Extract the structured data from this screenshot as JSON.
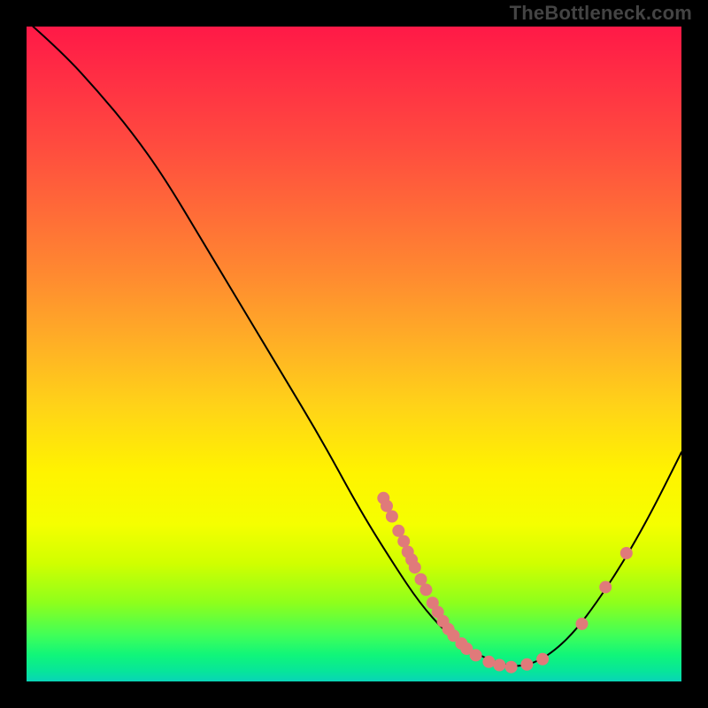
{
  "watermark": "TheBottleneck.com",
  "colors": {
    "curve": "#000000",
    "points": "#e07a7a",
    "gradient_top": "#ff1947",
    "gradient_bottom": "#09d4b8",
    "background": "#000000"
  },
  "chart_data": {
    "type": "line",
    "title": "",
    "xlabel": "",
    "ylabel": "",
    "x_range": [
      0,
      100
    ],
    "y_range": [
      0,
      100
    ],
    "note": "Axes are unlabeled; values are % positions in the 740x740 plot; y measured from top.",
    "curve": [
      [
        1,
        0
      ],
      [
        5.5,
        4
      ],
      [
        11,
        10
      ],
      [
        16,
        16
      ],
      [
        21,
        23
      ],
      [
        27,
        33
      ],
      [
        33,
        43
      ],
      [
        39,
        53
      ],
      [
        45,
        63
      ],
      [
        51,
        74
      ],
      [
        56,
        82
      ],
      [
        60,
        88
      ],
      [
        64,
        92.5
      ],
      [
        68,
        95.5
      ],
      [
        72,
        97.2
      ],
      [
        75,
        97.8
      ],
      [
        78,
        97
      ],
      [
        81,
        95
      ],
      [
        84,
        92
      ],
      [
        87,
        88
      ],
      [
        90,
        83.5
      ],
      [
        93,
        78.5
      ],
      [
        96,
        73
      ],
      [
        100,
        65
      ]
    ],
    "points": [
      [
        54.5,
        72.0
      ],
      [
        55.0,
        73.2
      ],
      [
        55.8,
        74.8
      ],
      [
        56.8,
        77.0
      ],
      [
        57.6,
        78.6
      ],
      [
        58.2,
        80.2
      ],
      [
        58.8,
        81.4
      ],
      [
        59.3,
        82.6
      ],
      [
        60.2,
        84.4
      ],
      [
        61.0,
        86.0
      ],
      [
        62.0,
        88.0
      ],
      [
        62.8,
        89.4
      ],
      [
        63.6,
        90.8
      ],
      [
        64.4,
        92.0
      ],
      [
        65.2,
        93.0
      ],
      [
        66.4,
        94.2
      ],
      [
        67.2,
        95.0
      ],
      [
        68.6,
        96.0
      ],
      [
        70.6,
        97.0
      ],
      [
        72.2,
        97.5
      ],
      [
        74.0,
        97.8
      ],
      [
        76.4,
        97.4
      ],
      [
        78.8,
        96.6
      ],
      [
        84.8,
        91.2
      ],
      [
        88.4,
        85.6
      ],
      [
        91.6,
        80.4
      ]
    ],
    "point_radius_pct": 0.95
  }
}
